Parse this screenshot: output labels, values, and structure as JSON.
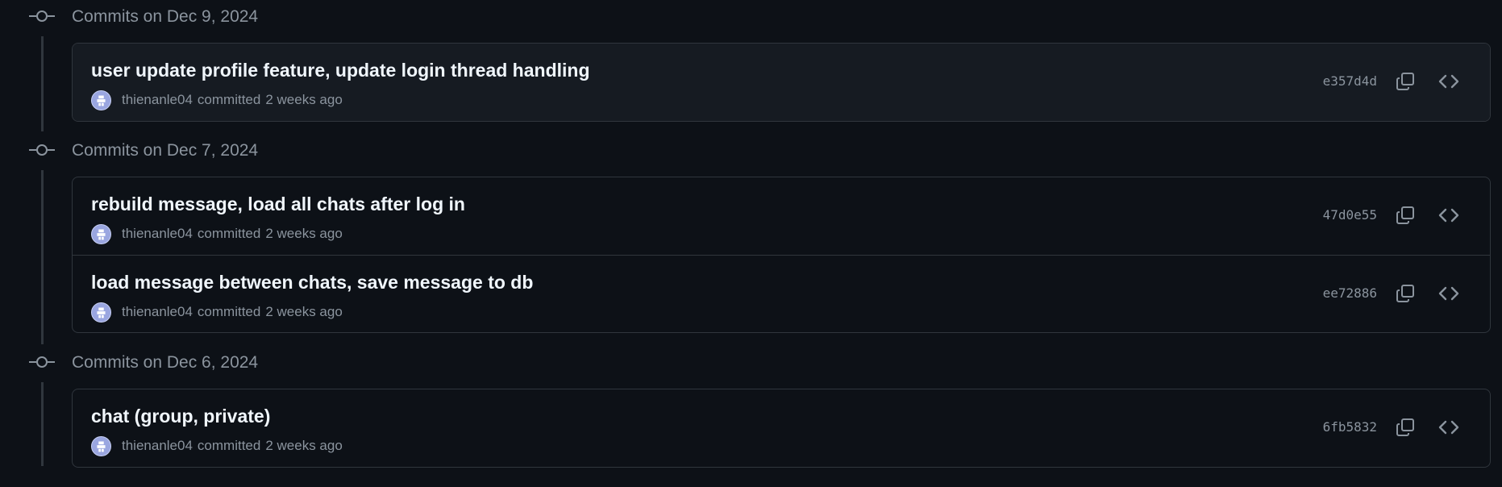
{
  "groups": [
    {
      "date_label": "Commits on Dec 9, 2024",
      "commits": [
        {
          "title": "user update profile feature, update login thread handling",
          "author": "thienanle04",
          "verb": "committed",
          "time": "2 weeks ago",
          "sha": "e357d4d",
          "highlighted": true
        }
      ]
    },
    {
      "date_label": "Commits on Dec 7, 2024",
      "commits": [
        {
          "title": "rebuild message, load all chats after log in",
          "author": "thienanle04",
          "verb": "committed",
          "time": "2 weeks ago",
          "sha": "47d0e55",
          "highlighted": false
        },
        {
          "title": "load message between chats, save message to db",
          "author": "thienanle04",
          "verb": "committed",
          "time": "2 weeks ago",
          "sha": "ee72886",
          "highlighted": false
        }
      ]
    },
    {
      "date_label": "Commits on Dec 6, 2024",
      "commits": [
        {
          "title": "chat (group, private)",
          "author": "thienanle04",
          "verb": "committed",
          "time": "2 weeks ago",
          "sha": "6fb5832",
          "highlighted": false
        }
      ]
    }
  ],
  "icons": {
    "group_marker": "git-commit-icon",
    "copy": "copy-icon",
    "browse": "code-icon",
    "avatar": "avatar-icon"
  },
  "colors": {
    "background": "#0d1117",
    "highlight_row": "#161b22",
    "border": "#30363d",
    "muted_text": "#8b949e",
    "title_text": "#f0f6fc",
    "avatar": "#9aa6e0"
  }
}
